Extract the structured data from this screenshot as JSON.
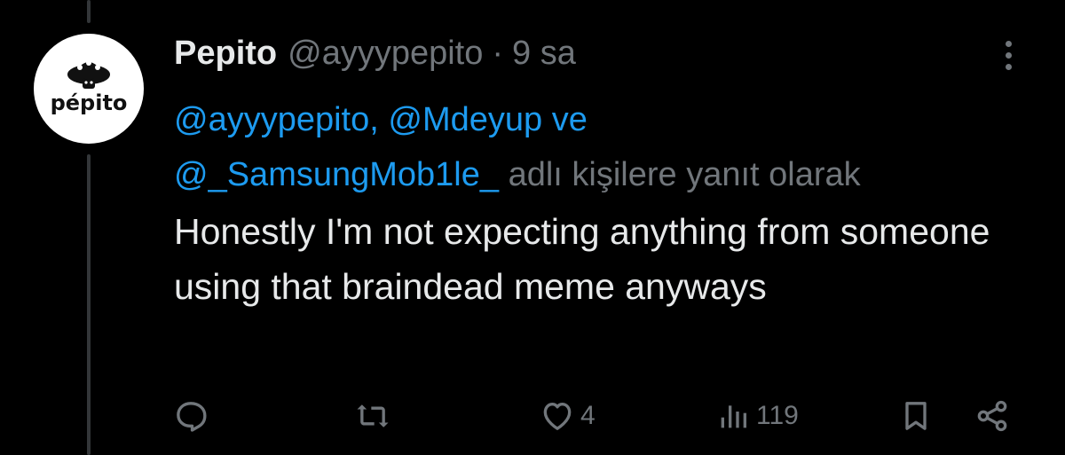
{
  "tweet": {
    "avatar_label": "pépito",
    "display_name": "Pepito",
    "handle": "@ayyypepito",
    "separator": "·",
    "time": "9 sa",
    "reply_context": {
      "mention_1": "@ayyypepito,",
      "mention_2": "@Mdeyup",
      "conjunction": "ve",
      "mention_3": "@_SamsungMob1le_",
      "suffix": "adlı kişilere yanıt olarak"
    },
    "text": "Honestly I'm not expecting anything from someone using that braindead meme anyways"
  },
  "actions": {
    "reply": {
      "icon": "reply-icon",
      "count": ""
    },
    "retweet": {
      "icon": "retweet-icon",
      "count": ""
    },
    "like": {
      "icon": "heart-icon",
      "count": "4"
    },
    "views": {
      "icon": "views-icon",
      "count": "119"
    },
    "bookmark": {
      "icon": "bookmark-icon"
    },
    "share": {
      "icon": "share-icon"
    }
  },
  "colors": {
    "background": "#000000",
    "primary_text": "#e7e9ea",
    "secondary_text": "#71767b",
    "link": "#1d9bf0",
    "thread_line": "#333639"
  }
}
